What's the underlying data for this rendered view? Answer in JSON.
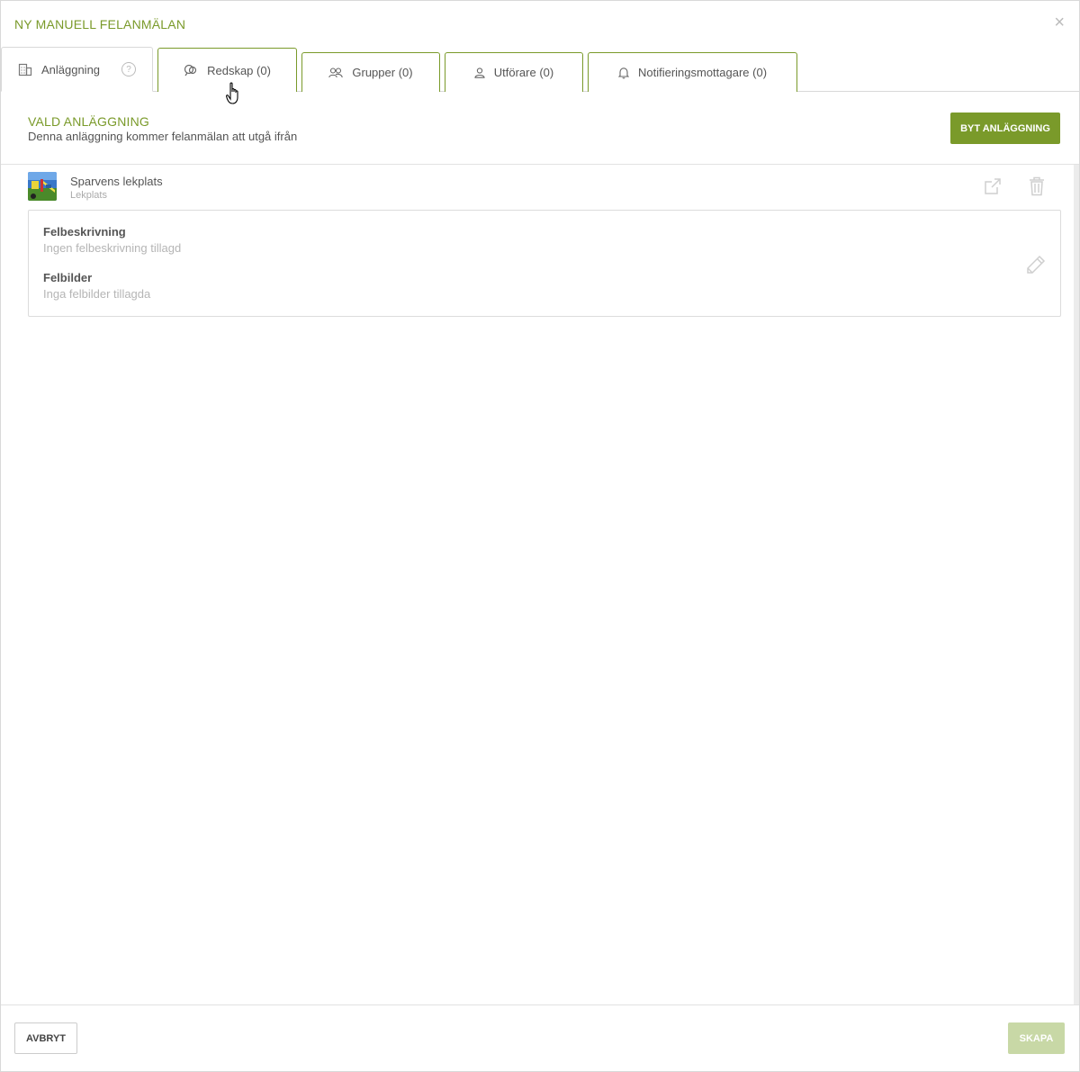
{
  "dialog": {
    "title": "NY MANUELL FELANMÄLAN",
    "close_label": "×"
  },
  "tabs": [
    {
      "label": "Anläggning",
      "icon": "building-icon",
      "help": "?",
      "active": true
    },
    {
      "label": "Redskap (0)",
      "icon": "equipment-icon",
      "active": false
    },
    {
      "label": "Grupper (0)",
      "icon": "group-icon",
      "active": false
    },
    {
      "label": "Utförare (0)",
      "icon": "person-icon",
      "active": false
    },
    {
      "label": "Notifieringsmottagare (0)",
      "icon": "bell-icon",
      "active": false
    }
  ],
  "section": {
    "title": "VALD ANLÄGGNING",
    "subtitle": "Denna anläggning kommer felanmälan att utgå ifrån",
    "change_button": "BYT ANLÄGGNING"
  },
  "facility": {
    "name": "Sparvens lekplats",
    "type": "Lekplats"
  },
  "details": {
    "description_label": "Felbeskrivning",
    "description_value": "Ingen felbeskrivning tillagd",
    "images_label": "Felbilder",
    "images_value": "Inga felbilder tillagda"
  },
  "footer": {
    "cancel_label": "AVBRYT",
    "create_label": "SKAPA"
  },
  "colors": {
    "accent": "#7a9a2a",
    "accent_disabled": "#c8d8a6",
    "muted_text": "#b5b5b5"
  }
}
